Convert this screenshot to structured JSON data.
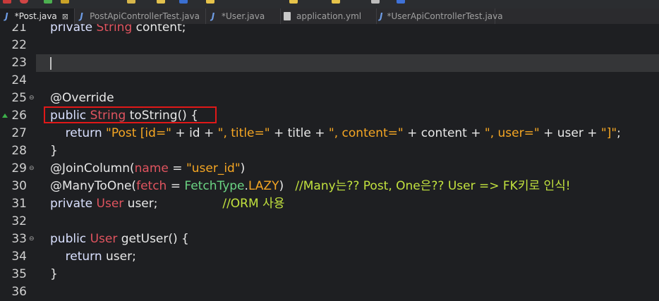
{
  "tabs": [
    {
      "label": "*Post.java",
      "icon": "java-icon",
      "active": true,
      "close": "⊠"
    },
    {
      "label": "PostApiControllerTest.java",
      "icon": "java-icon",
      "active": false
    },
    {
      "label": "*User.java",
      "icon": "java-icon",
      "active": false
    },
    {
      "label": "application.yml",
      "icon": "yml-file-icon",
      "active": false
    },
    {
      "label": "*UserApiControllerTest.java",
      "icon": "java-icon",
      "active": false
    }
  ],
  "lines": [
    {
      "num": "21",
      "code": [
        [
          "kw",
          "private "
        ],
        [
          "ty",
          "String "
        ],
        [
          "fn",
          "content;"
        ]
      ]
    },
    {
      "num": "22",
      "code": []
    },
    {
      "num": "23",
      "code": [],
      "current": true
    },
    {
      "num": "24",
      "code": []
    },
    {
      "num": "25",
      "fold": true,
      "code": [
        [
          "an",
          "@Override"
        ]
      ]
    },
    {
      "num": "26",
      "marker": true,
      "code": [
        [
          "kw",
          "public "
        ],
        [
          "ty",
          "String "
        ],
        [
          "fn",
          "toString() {"
        ]
      ]
    },
    {
      "num": "27",
      "code": [
        [
          "kw",
          "    return "
        ],
        [
          "str",
          "\"Post [id=\""
        ],
        [
          "fn",
          " + id + "
        ],
        [
          "str",
          "\", title=\""
        ],
        [
          "fn",
          " + title + "
        ],
        [
          "str",
          "\", content=\""
        ],
        [
          "fn",
          " + content + "
        ],
        [
          "str",
          "\", user=\""
        ],
        [
          "fn",
          " + user + "
        ],
        [
          "str",
          "\"]\""
        ],
        [
          "fn",
          ";"
        ]
      ]
    },
    {
      "num": "28",
      "code": [
        [
          "fn",
          "}"
        ]
      ]
    },
    {
      "num": "29",
      "fold": true,
      "code": [
        [
          "an",
          "@JoinColumn("
        ],
        [
          "prm",
          "name"
        ],
        [
          "fn",
          " = "
        ],
        [
          "str",
          "\"user_id\""
        ],
        [
          "fn",
          ")"
        ]
      ]
    },
    {
      "num": "30",
      "code": [
        [
          "an",
          "@ManyToOne("
        ],
        [
          "prm",
          "fetch"
        ],
        [
          "fn",
          " = "
        ],
        [
          "cls",
          "FetchType"
        ],
        [
          "fn",
          "."
        ],
        [
          "str",
          "LAZY"
        ],
        [
          "fn",
          ")   "
        ],
        [
          "cm",
          "//Many는?? Post, One은?? User => FK키로 인식!"
        ]
      ]
    },
    {
      "num": "31",
      "code": [
        [
          "kw",
          "private "
        ],
        [
          "ty",
          "User "
        ],
        [
          "fn",
          "user;                 "
        ],
        [
          "cm",
          "//ORM 사용"
        ]
      ]
    },
    {
      "num": "32",
      "code": []
    },
    {
      "num": "33",
      "fold": true,
      "code": [
        [
          "kw",
          "public "
        ],
        [
          "ty",
          "User "
        ],
        [
          "fn",
          "getUser() {"
        ]
      ]
    },
    {
      "num": "34",
      "code": [
        [
          "kw",
          "    return "
        ],
        [
          "fn",
          "user;"
        ]
      ]
    },
    {
      "num": "35",
      "code": [
        [
          "fn",
          "}"
        ]
      ]
    },
    {
      "num": "36",
      "code": []
    }
  ]
}
